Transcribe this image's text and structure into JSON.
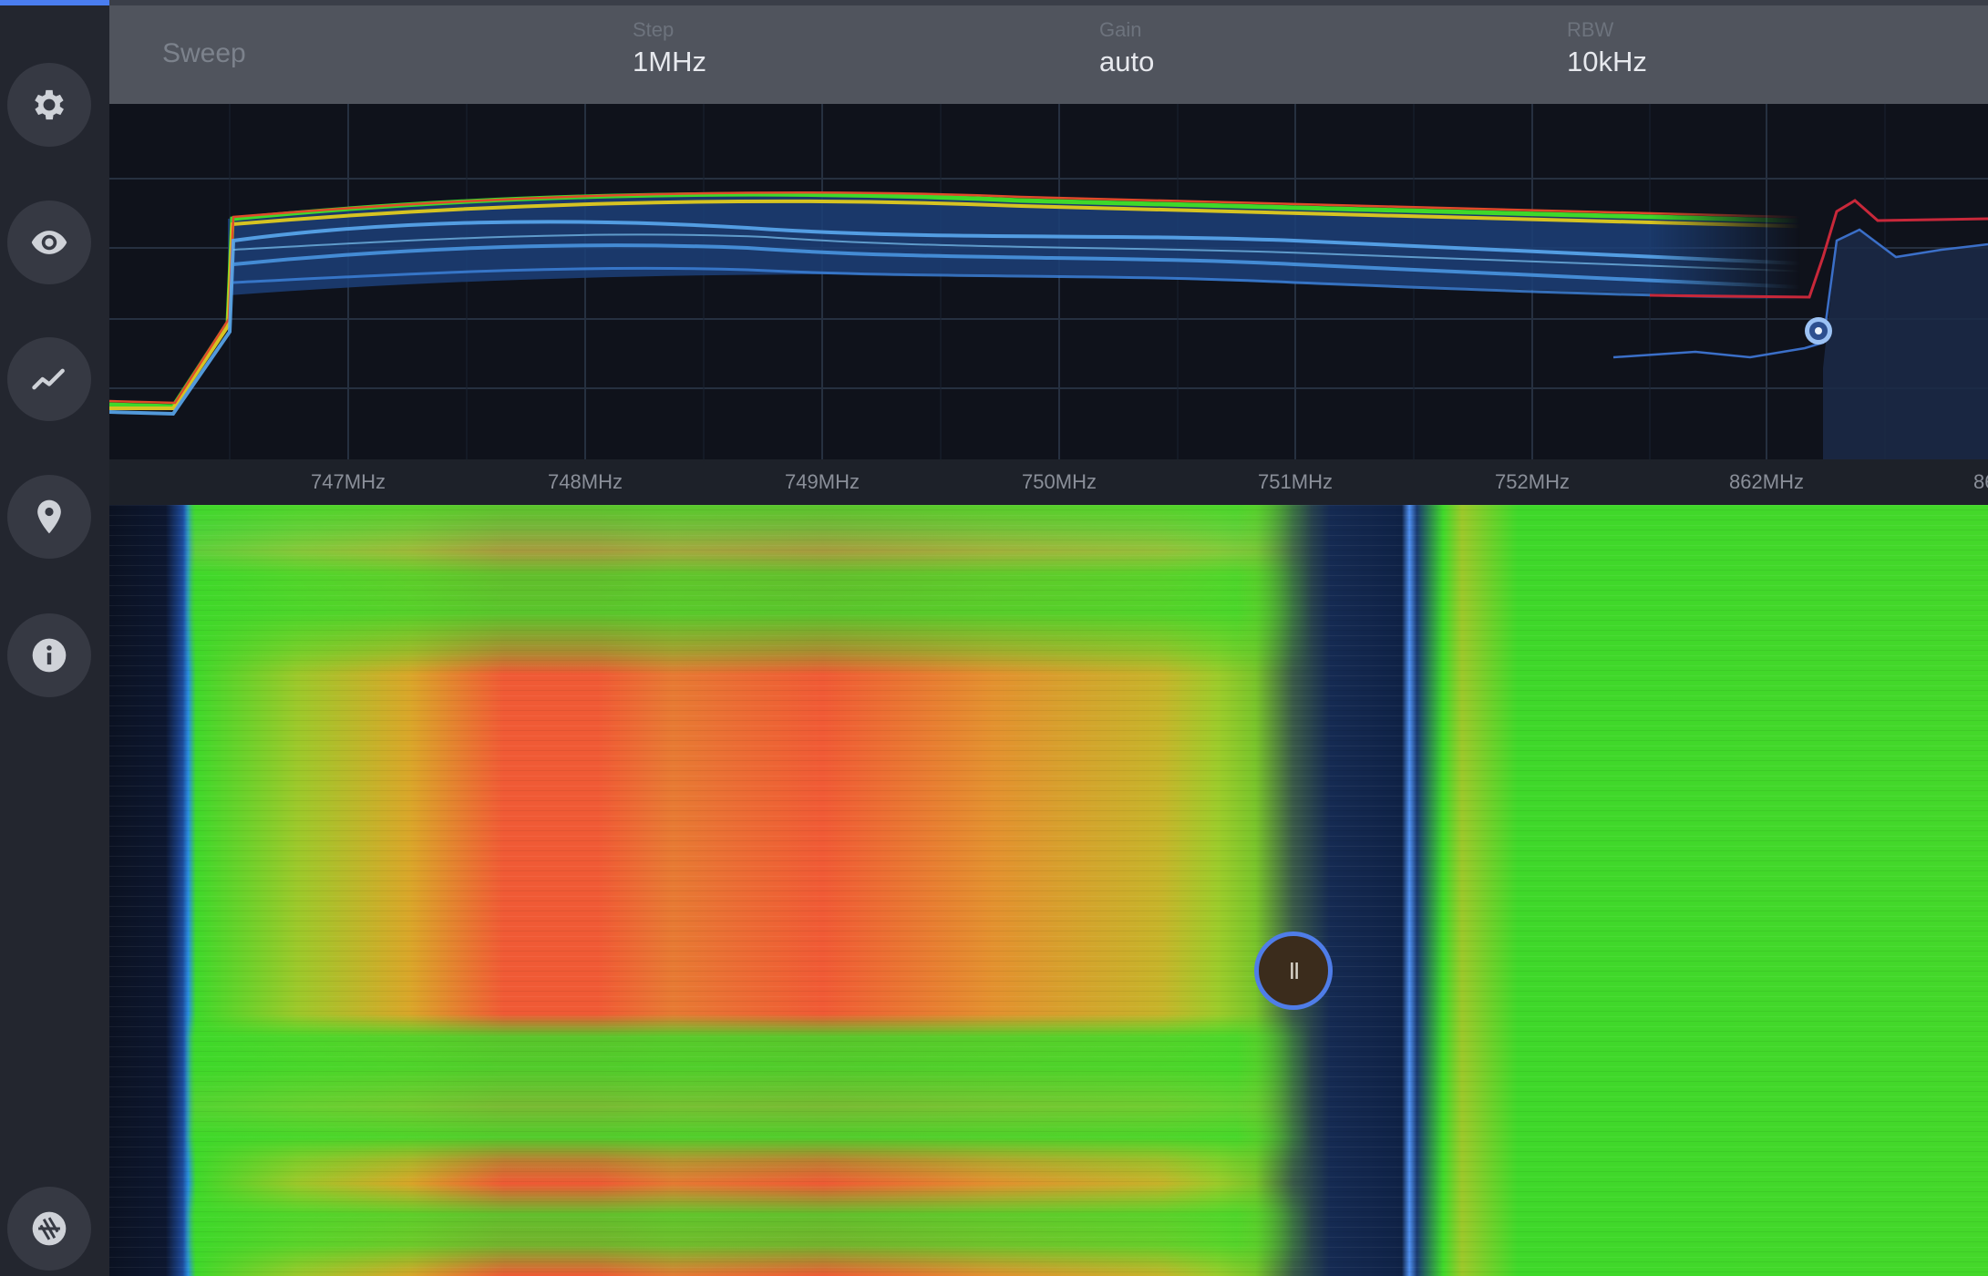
{
  "header": {
    "title": "Sweep",
    "step": {
      "label": "Step",
      "value": "1MHz"
    },
    "gain": {
      "label": "Gain",
      "value": "auto"
    },
    "rbw": {
      "label": "RBW",
      "value": "10kHz"
    }
  },
  "sidebar": {
    "top_buttons": [
      "gear-icon",
      "eye-icon",
      "trend-icon",
      "location-pin-icon",
      "info-icon"
    ],
    "bottom_button": "aperture-icon"
  },
  "frequency_axis": {
    "ticks": [
      "747MHz",
      "748MHz",
      "749MHz",
      "750MHz",
      "751MHz",
      "752MHz",
      "862MHz",
      "86"
    ]
  },
  "controls": {
    "pause_symbol": "II"
  },
  "colors": {
    "accent": "#4f7de8",
    "trace_blue": "#3b8fe8",
    "trace_red": "#c8283a",
    "heat_hot": "#f05a35",
    "heat_mid": "#c6b42a",
    "heat_low": "#3fd82a",
    "noise_floor": "#0d1730"
  }
}
